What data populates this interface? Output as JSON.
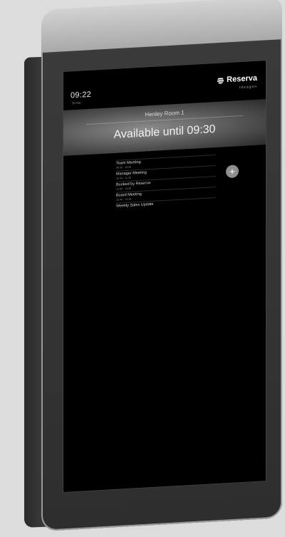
{
  "screen": {
    "time": "09:22",
    "date": "20 Feb",
    "brand": "Reserva",
    "brand_sub": "Ideagen"
  },
  "room": {
    "name": "Henley Room 1",
    "status": "Available until 09:30"
  },
  "meetings": [
    {
      "title": "Team Meeting",
      "time": "09:30 - 10:30"
    },
    {
      "title": "Manager Meeting",
      "time": "10:45 - 11:45"
    },
    {
      "title": "Booked by Reserva",
      "time": "12:30 - 13:30"
    },
    {
      "title": "Board Meeting",
      "time": "13:45 - 14:45"
    },
    {
      "title": "Weekly Sales Update",
      "time": ""
    }
  ],
  "actions": {
    "add_label": "+"
  }
}
